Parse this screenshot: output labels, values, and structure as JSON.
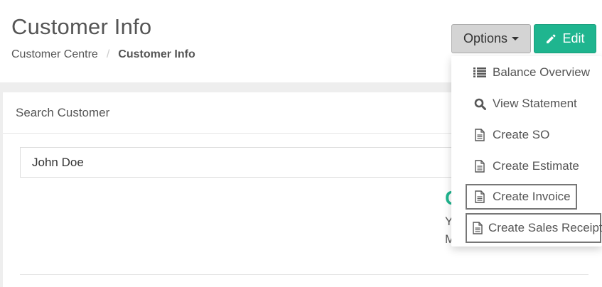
{
  "header": {
    "title": "Customer Info",
    "breadcrumb": [
      {
        "label": "Customer Centre"
      },
      {
        "label": "Customer Info"
      }
    ],
    "breadcrumb_separator": "/"
  },
  "toolbar": {
    "options_label": "Options",
    "edit_label": "Edit",
    "edit_color": "#1fb58f"
  },
  "panel": {
    "heading": "Search Customer",
    "search_value": "John Doe",
    "partial_heading": "C",
    "partial_line1": "Y",
    "partial_line2": "M"
  },
  "dropdown": {
    "items": [
      {
        "label": "Balance Overview",
        "icon": "list-icon"
      },
      {
        "label": "View Statement",
        "icon": "search-icon"
      },
      {
        "label": "Create SO",
        "icon": "document-icon"
      },
      {
        "label": "Create Estimate",
        "icon": "document-icon"
      },
      {
        "label": "Create Invoice",
        "icon": "document-icon"
      },
      {
        "label": "Create Sales Receipt",
        "icon": "document-icon"
      }
    ]
  }
}
